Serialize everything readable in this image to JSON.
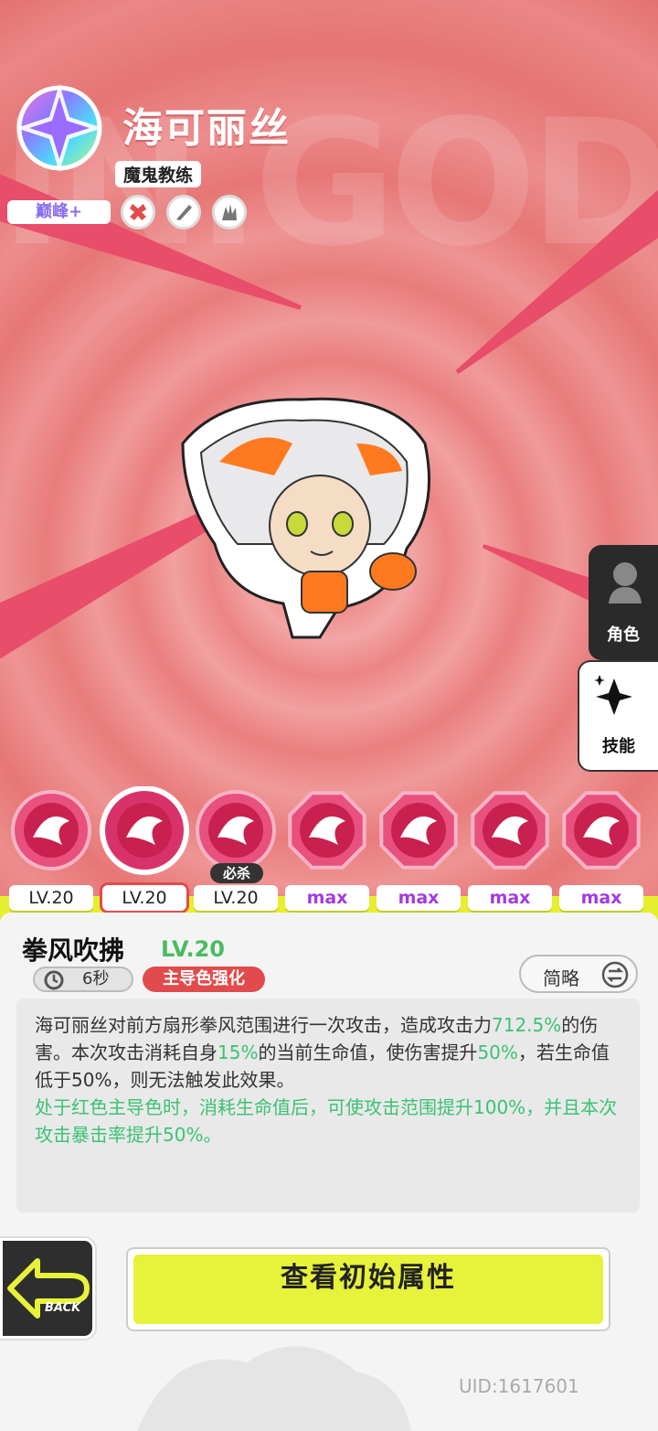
{
  "header": {
    "character_name": "海可丽丝",
    "title_tag": "魔鬼教练",
    "rank": "巅峰+",
    "background_word": "IN.GOD"
  },
  "side_tabs": [
    {
      "label": "角色"
    },
    {
      "label": "技能"
    }
  ],
  "skills": [
    {
      "level": "LV.20",
      "icon": "fist-spin-icon"
    },
    {
      "level": "LV.20",
      "icon": "wind-fist-icon",
      "selected": true
    },
    {
      "level": "LV.20",
      "icon": "boom-icon",
      "badge": "必杀"
    },
    {
      "level": "max",
      "icon": "star-burst-icon"
    },
    {
      "level": "max",
      "icon": "up-arrow-icon"
    },
    {
      "level": "max",
      "icon": "vortex-icon"
    },
    {
      "level": "max",
      "icon": "swirl-star-icon"
    }
  ],
  "skill_detail": {
    "name": "拳风吹拂",
    "level": "LV.20",
    "cooldown": "6秒",
    "boost_tag": "主导色强化",
    "brief_button": "简略",
    "desc_parts": [
      "海可丽丝对前方扇形拳风范围进行一次攻击，造成攻击力",
      "712.5%",
      "的伤害。本次攻击消耗自身",
      "15%",
      "的当前生命值，使伤害提升",
      "50%",
      "，若生命值低于50%，则无法触发此效果。"
    ],
    "desc_green": "处于红色主导色时，消耗生命值后，可使攻击范围提升100%，并且本次攻击暴击率提升50%。"
  },
  "footer": {
    "back_label": "BACK",
    "view_button": "查看初始属性",
    "uid": "UID:1617601"
  },
  "colors": {
    "accent_yellow": "#e7f23b",
    "green_text": "#3cc276",
    "red_tag": "#e24b4b",
    "max_purple": "#a23be0"
  }
}
